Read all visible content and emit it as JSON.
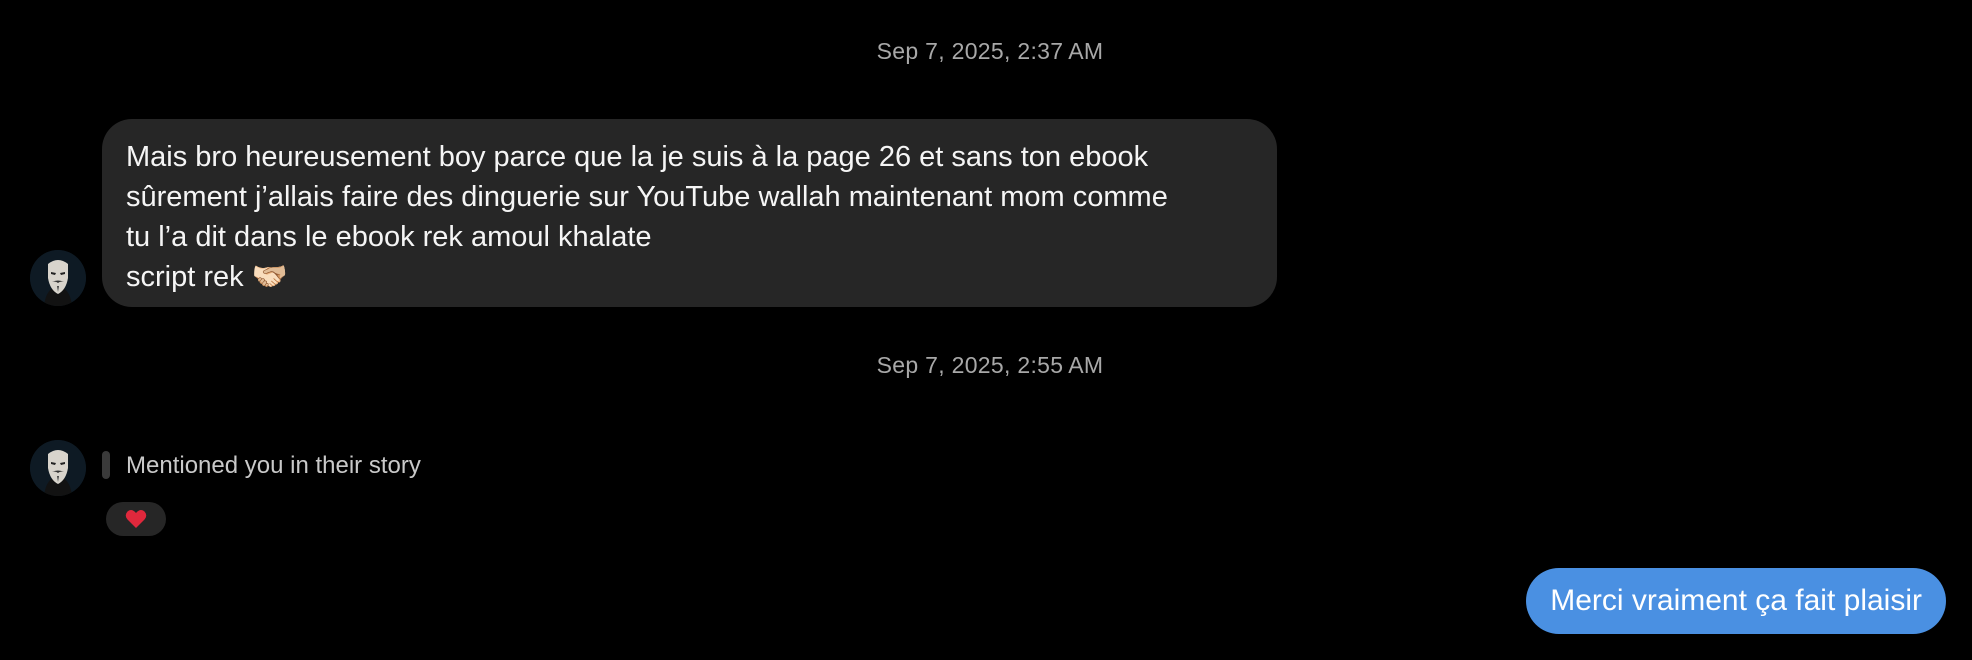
{
  "thread": {
    "timestamps": [
      "Sep 7, 2025, 2:37 AM",
      "Sep 7, 2025, 2:55 AM"
    ],
    "incoming_message": {
      "text": "Mais bro heureusement boy parce que la je suis à la page 26 et sans ton ebook\nsûrement j’allais faire des dinguerie sur YouTube wallah maintenant mom comme\ntu l’a dit dans le ebook rek amoul khalate\nscript rek 🫱🏻‍🫲🏼"
    },
    "story_mention": {
      "text": "Mentioned you in their story",
      "reaction_icon": "heart-icon"
    },
    "outgoing_message": {
      "text": "Merci vraiment ça fait plaisir"
    }
  },
  "colors": {
    "background": "#000000",
    "incoming_bubble": "#262626",
    "outgoing_bubble": "#4a90e2",
    "timestamp": "#a8a8a8",
    "reaction_heart": "#e0283c"
  }
}
